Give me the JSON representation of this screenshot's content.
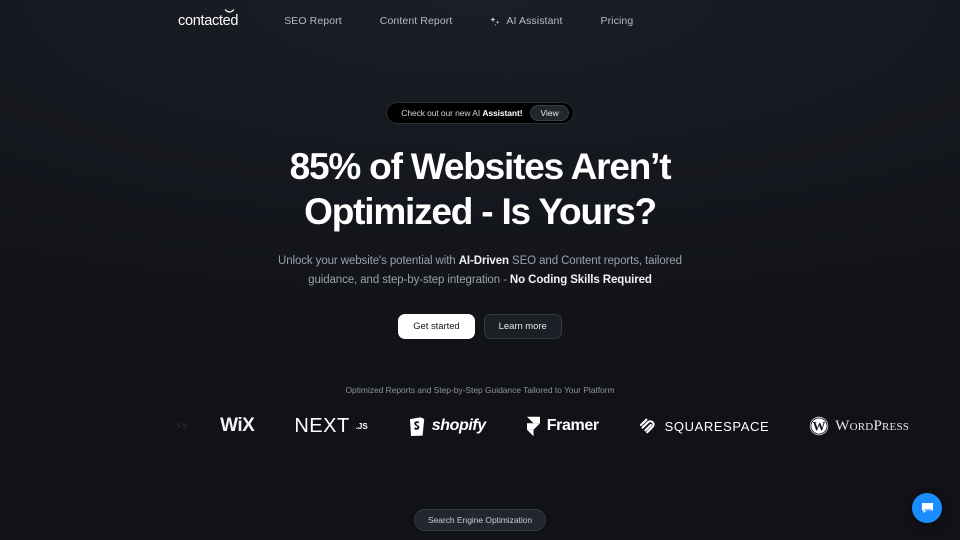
{
  "theme": {
    "background": "#14161c",
    "text_primary": "#ffffff",
    "text_muted": "#9ba0ab",
    "accent_chat": "#1a8cff"
  },
  "nav": {
    "brand": "contacted",
    "brand_mark": "smile-curve",
    "links": [
      {
        "label": "SEO Report",
        "icon": null
      },
      {
        "label": "Content Report",
        "icon": null
      },
      {
        "label": "AI Assistant",
        "icon": "sparkle-icon"
      },
      {
        "label": "Pricing",
        "icon": null
      }
    ]
  },
  "announcement": {
    "text_plain": "Check out our new AI ",
    "text_bold": "Assistant!",
    "button_label": "View"
  },
  "hero": {
    "headline_line1": "85% of Websites Aren’t",
    "headline_line2": "Optimized - Is Yours?",
    "subhead_line1_a": "Unlock your website's potential with ",
    "subhead_line1_b": "AI-Driven",
    "subhead_line1_c": " SEO and Content reports, tailored",
    "subhead_line2_a": "guidance, and step-by-step integration - ",
    "subhead_line2_b": "No Coding Skills Required",
    "cta_primary": "Get started",
    "cta_secondary": "Learn more"
  },
  "logos": {
    "caption": "Optimized Reports and Step-by-Step Guidance Tailored to Your Platform",
    "ghost_fragment": "ss",
    "items": [
      {
        "name": "WiX",
        "icon": null
      },
      {
        "name": "NEXT",
        "suffix": ".JS",
        "icon": null
      },
      {
        "name": "shopify",
        "icon": "shopify-bag-icon"
      },
      {
        "name": "Framer",
        "icon": "framer-icon"
      },
      {
        "name": "SQUARESPACE",
        "icon": "squarespace-icon"
      },
      {
        "name": "WordPress",
        "icon": "wordpress-icon"
      }
    ]
  },
  "tag": {
    "label": "Search Engine Optimization"
  },
  "chat": {
    "icon": "chat-bubble-icon",
    "aria_label": "Open chat"
  }
}
